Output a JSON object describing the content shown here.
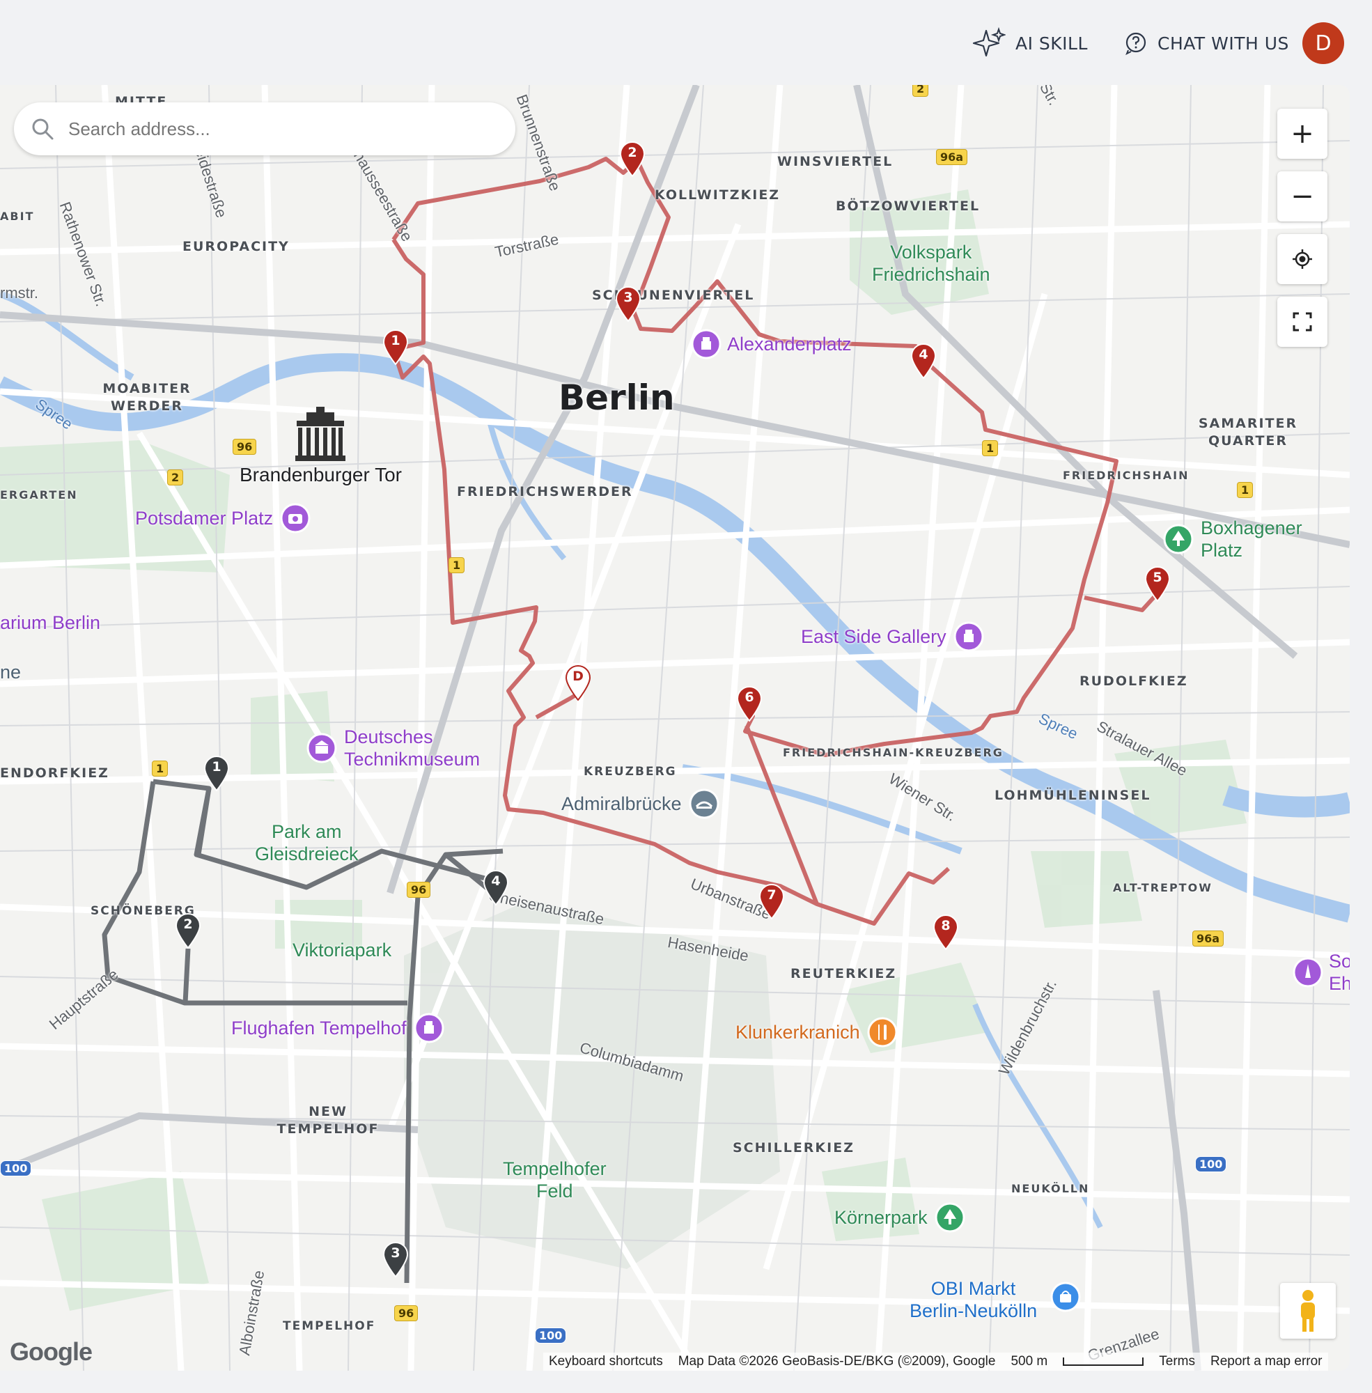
{
  "header": {
    "ai_skill": "AI SKILL",
    "chat": "CHAT WITH US",
    "avatar_letter": "D",
    "avatar_color": "#c0391b"
  },
  "search": {
    "placeholder": "Search address..."
  },
  "controls": {
    "zoom_in": "+",
    "zoom_out": "−"
  },
  "map": {
    "city": "Berlin",
    "districts": [
      "MITTE",
      "WINSVIERTEL",
      "KOLLWITZKIEZ",
      "BÖTZOWVIERTEL",
      "EUROPACITY",
      "SCHEUNENVIERTEL",
      "MOABITER WERDER",
      "SAMARITER QUARTER",
      "FRIEDRICHSWERDER",
      "FRIEDRICHSHAIN",
      "RUDOLFKIEZ",
      "FRIEDRICHSHAIN-KREUZBERG",
      "KREUZBERG",
      "LOHMÜHLENINSEL",
      "ENDORFKIEZ",
      "ALT-TREPTOW",
      "SCHÖNEBERG",
      "REUTERKIEZ",
      "NEW TEMPELHOF",
      "SCHILLERKIEZ",
      "NEUKÖLLN",
      "TEMPELHOF",
      "ERGARTEN",
      "ABIT"
    ],
    "pois": {
      "alexanderplatz": "Alexanderplatz",
      "brandenburger": "Brandenburger Tor",
      "potsdamer": "Potsdamer Platz",
      "planetarium": "arium Berlin",
      "volkspark": "Volkspark\nFriedrichshain",
      "boxhagener": "Boxhagener\nPlatz",
      "eastside": "East Side Gallery",
      "technik": "Deutsches\nTechnikmuseum",
      "admiral": "Admiralbrücke",
      "gleisdreieck": "Park am\nGleisdreieck",
      "viktoriapark": "Viktoriapark",
      "flughafen": "Flughafen Tempelhof",
      "klunker": "Klunkerkranich",
      "tempelhofer": "Tempelhofer\nFeld",
      "koernerpark": "Körnerpark",
      "obi": "OBI Markt\nBerlin-Neukölln",
      "so_eh": "So\nEh",
      "ne": "ne"
    },
    "streets": [
      "Torstraße",
      "Brunnenstraße",
      "Chausseestraße",
      "Heidestraße",
      "Rathenower Str.",
      "rmstr.",
      "Spree",
      "Stralauer Allee",
      "Wiener Str.",
      "Urbanstraße",
      "Hasenheide",
      "Gneisenaustraße",
      "Columbiadamm",
      "Wildenbruchstr.",
      "Hauptstraße",
      "Alboinstraße",
      "Grenzallee",
      "Str."
    ],
    "red_route_stops": [
      "1",
      "2",
      "3",
      "4",
      "5",
      "6",
      "7",
      "8"
    ],
    "gray_route_stops": [
      "1",
      "2",
      "3",
      "4"
    ],
    "destination_label": "D",
    "route_colors": {
      "red": "#c0392b",
      "gray": "#3c4043"
    }
  },
  "footer": {
    "google": "Google",
    "keyboard": "Keyboard shortcuts",
    "mapdata": "Map Data ©2026 GeoBasis-DE/BKG (©2009), Google",
    "scale": "500 m",
    "terms": "Terms",
    "report": "Report a map error"
  }
}
